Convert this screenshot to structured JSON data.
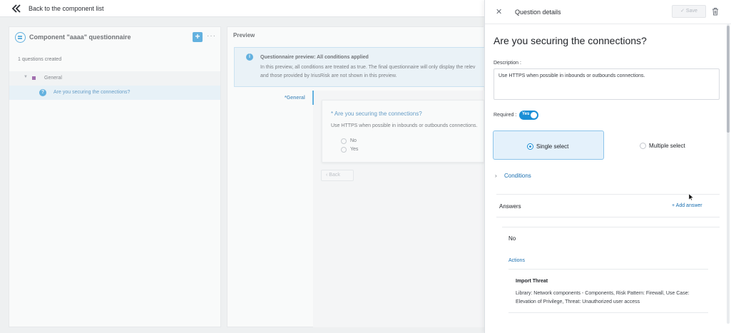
{
  "topbar": {
    "back_label": "Back to the component list"
  },
  "left_panel": {
    "title": "Component \"aaaa\" questionnaire",
    "add_label": "+",
    "more_label": "···",
    "count_text": "1 questions created",
    "group_label": "General",
    "question_item": "Are you securing the connections?"
  },
  "preview": {
    "header": "Preview",
    "info_title": "Questionnaire preview: All conditions applied",
    "info_line1": "In this preview, all conditions are treated as true. The final questionnaire will only display the relev",
    "info_line2": "and those provided by IriusRisk are not shown in this preview.",
    "side_tab": "*General",
    "card_title": "* Are you securing the connections?",
    "card_desc": "Use HTTPS when possible in inbounds or outbounds connections.",
    "options": [
      "No",
      "Yes"
    ],
    "back_button": "‹ Back"
  },
  "drawer": {
    "title": "Question details",
    "save_label": "✓  Save",
    "question": "Are you securing the connections?",
    "description_label": "Description :",
    "description_value": "Use HTTPS when possible in inbounds or outbounds connections.",
    "required_label": "Required :",
    "required_toggle": "Yes",
    "single_select": "Single select",
    "multiple_select": "Multiple select",
    "conditions_label": "Conditions",
    "answers_label": "Answers",
    "add_answer": "+  Add answer",
    "answer_name": "No",
    "actions_label": "Actions",
    "action_title": "Import Threat",
    "action_desc_line1": "Library: Network components - Components, Risk Pattern: Firewall, Use Case:",
    "action_desc_line2": "Elevation of Privilege, Threat: Unauthorized user access"
  },
  "colors": {
    "accent": "#1a8fd6",
    "link": "#1a6fb0",
    "selected_bg": "#e4f1fb",
    "group_marker": "#7a2b8c"
  }
}
